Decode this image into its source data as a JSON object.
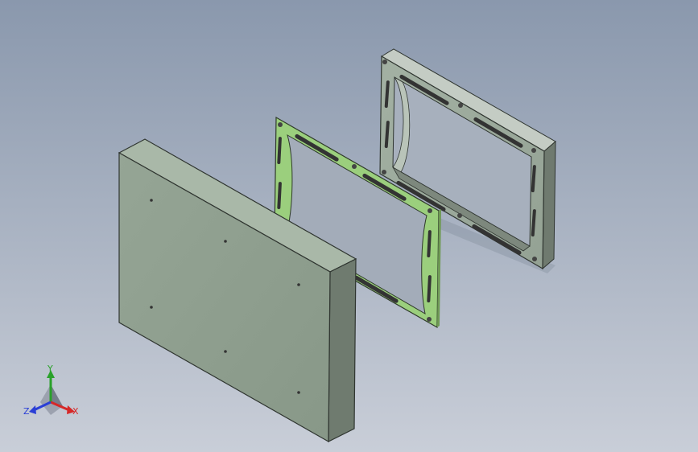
{
  "viewport": {
    "background_top": "#8a98ad",
    "background_bottom": "#c9ced8"
  },
  "model": {
    "parts": [
      {
        "name": "cover-plate",
        "color": "#8f9e8f"
      },
      {
        "name": "gasket",
        "color": "#9bcf7d"
      },
      {
        "name": "frame",
        "color": "#9aa89a"
      }
    ]
  },
  "triad": {
    "x_label": "X",
    "y_label": "Y",
    "z_label": "Z",
    "x_color": "#d62828",
    "y_color": "#2aa12a",
    "z_color": "#2a3fd6",
    "icon": "coordinate-triad-icon"
  }
}
